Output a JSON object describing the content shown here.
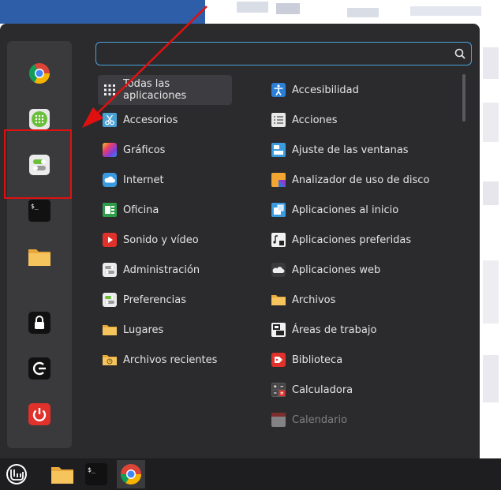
{
  "search": {
    "placeholder": "",
    "value": ""
  },
  "categories": [
    {
      "label": "Todas las aplicaciones",
      "icon": "grid-icon"
    },
    {
      "label": "Accesorios",
      "icon": "scissors-icon"
    },
    {
      "label": "Gráficos",
      "icon": "graphics-icon"
    },
    {
      "label": "Internet",
      "icon": "cloud-icon"
    },
    {
      "label": "Oficina",
      "icon": "office-icon"
    },
    {
      "label": "Sonido y vídeo",
      "icon": "play-icon"
    },
    {
      "label": "Administración",
      "icon": "toggle-icon"
    },
    {
      "label": "Preferencias",
      "icon": "toggle-green-icon"
    },
    {
      "label": "Lugares",
      "icon": "folder-icon"
    },
    {
      "label": "Archivos recientes",
      "icon": "folder-clock-icon"
    }
  ],
  "apps": [
    {
      "label": "Accesibilidad",
      "icon": "accessibility-icon"
    },
    {
      "label": "Acciones",
      "icon": "list-icon"
    },
    {
      "label": "Ajuste de las ventanas",
      "icon": "window-tile-icon"
    },
    {
      "label": "Analizador de uso de disco",
      "icon": "disk-usage-icon"
    },
    {
      "label": "Aplicaciones al inicio",
      "icon": "startup-apps-icon"
    },
    {
      "label": "Aplicaciones preferidas",
      "icon": "preferred-apps-icon"
    },
    {
      "label": "Aplicaciones web",
      "icon": "web-apps-icon"
    },
    {
      "label": "Archivos",
      "icon": "folder-icon"
    },
    {
      "label": "Áreas de trabajo",
      "icon": "workspaces-icon"
    },
    {
      "label": "Biblioteca",
      "icon": "library-icon"
    },
    {
      "label": "Calculadora",
      "icon": "calculator-icon"
    },
    {
      "label": "Calendario",
      "icon": "calendar-icon"
    }
  ],
  "favorites": [
    "chrome-icon",
    "calculator-keypad-icon",
    "settings-toggle-icon",
    "terminal-icon",
    "folder-icon",
    "lock-icon",
    "logout-icon",
    "power-icon"
  ],
  "colors": {
    "accent": "#4aa1d6",
    "panel": "#2b2b2e",
    "annotation": "#e01010"
  }
}
